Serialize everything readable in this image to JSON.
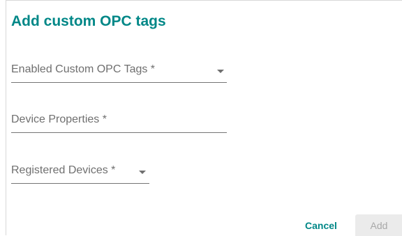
{
  "dialog": {
    "title": "Add custom OPC tags",
    "fields": [
      {
        "label": "Enabled Custom OPC Tags *",
        "type": "select"
      },
      {
        "label": "Device Properties *",
        "type": "text"
      },
      {
        "label": "Registered Devices *",
        "type": "select"
      }
    ],
    "actions": {
      "cancel_label": "Cancel",
      "add_label": "Add",
      "add_disabled": true
    }
  },
  "colors": {
    "accent": "#008787",
    "label": "#6f6f6f",
    "disabled_bg": "#ebebeb",
    "disabled_text": "#a8a8a8"
  },
  "icons": {
    "dropdown": "chevron-down-icon"
  }
}
